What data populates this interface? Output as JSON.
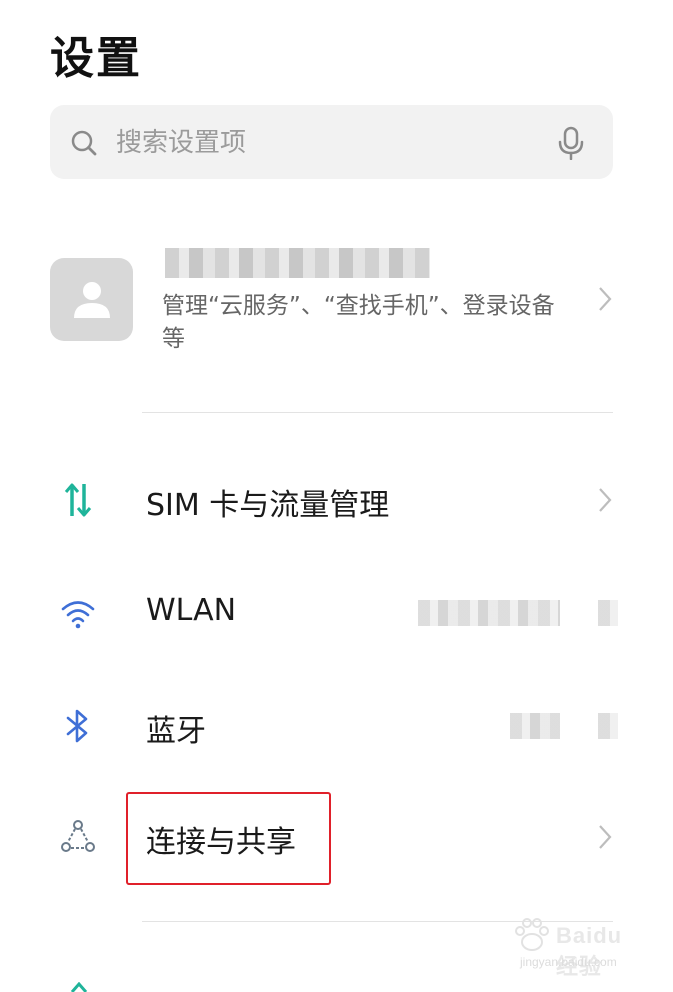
{
  "header": {
    "title": "设置"
  },
  "search": {
    "placeholder": "搜索设置项"
  },
  "account": {
    "description": "管理“云服务”、“查找手机”、登录设备等"
  },
  "rows": [
    {
      "label": "SIM 卡与流量管理",
      "icon": "sim-data-icon"
    },
    {
      "label": "WLAN",
      "icon": "wifi-icon"
    },
    {
      "label": "蓝牙",
      "icon": "bluetooth-icon"
    },
    {
      "label": "连接与共享",
      "icon": "share-icon"
    }
  ],
  "watermark": {
    "brand": "Baidu经验",
    "url": "jingyan.baidu.com"
  },
  "colors": {
    "accent_teal": "#1fb49a",
    "accent_blue": "#3f6fd6",
    "highlight_red": "#e0202a"
  }
}
